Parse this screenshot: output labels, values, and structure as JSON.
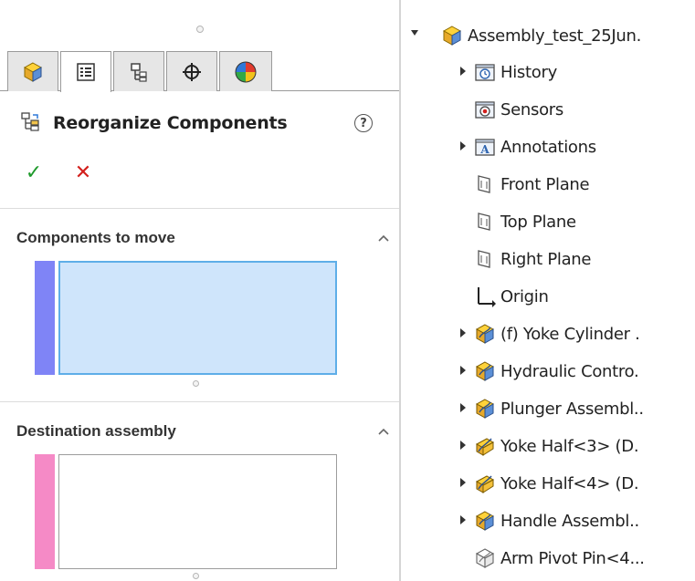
{
  "property_manager": {
    "tabs": [
      {
        "icon": "feature-manager-icon",
        "active": false
      },
      {
        "icon": "property-manager-icon",
        "active": true
      },
      {
        "icon": "configuration-manager-icon",
        "active": false
      },
      {
        "icon": "dimxpert-manager-icon",
        "active": false
      },
      {
        "icon": "display-manager-icon",
        "active": false
      }
    ],
    "title": "Reorganize Components",
    "help_glyph": "?",
    "ok_glyph": "✓",
    "cancel_glyph": "✕",
    "groups": {
      "components_to_move": {
        "label": "Components to move",
        "color": "#7f84f6"
      },
      "destination_assembly": {
        "label": "Destination assembly",
        "color": "#f58ac6"
      }
    }
  },
  "feature_tree": {
    "root": {
      "label": "Assembly_test_25Jun.",
      "icon": "assembly-icon",
      "expanded": true
    },
    "items": [
      {
        "label": "History",
        "icon": "history-folder-icon",
        "expandable": true
      },
      {
        "label": "Sensors",
        "icon": "sensors-folder-icon",
        "expandable": false
      },
      {
        "label": "Annotations",
        "icon": "annotations-folder-icon",
        "expandable": true
      },
      {
        "label": "Front Plane",
        "icon": "plane-icon",
        "expandable": false
      },
      {
        "label": "Top Plane",
        "icon": "plane-icon",
        "expandable": false
      },
      {
        "label": "Right Plane",
        "icon": "plane-icon",
        "expandable": false
      },
      {
        "label": "Origin",
        "icon": "origin-icon",
        "expandable": false
      },
      {
        "label": "(f) Yoke Cylinder .",
        "icon": "subassembly-icon",
        "expandable": true
      },
      {
        "label": "Hydraulic Contro.",
        "icon": "subassembly-icon",
        "expandable": true
      },
      {
        "label": "Plunger Assembl..",
        "icon": "subassembly-icon",
        "expandable": true
      },
      {
        "label": "Yoke Half<3> (D.",
        "icon": "part-icon",
        "expandable": true
      },
      {
        "label": "Yoke Half<4> (D.",
        "icon": "part-icon",
        "expandable": true
      },
      {
        "label": "Handle Assembl..",
        "icon": "subassembly-icon",
        "expandable": true
      },
      {
        "label": "Arm Pivot Pin<4...",
        "icon": "suppressed-part-icon",
        "expandable": false
      }
    ]
  }
}
